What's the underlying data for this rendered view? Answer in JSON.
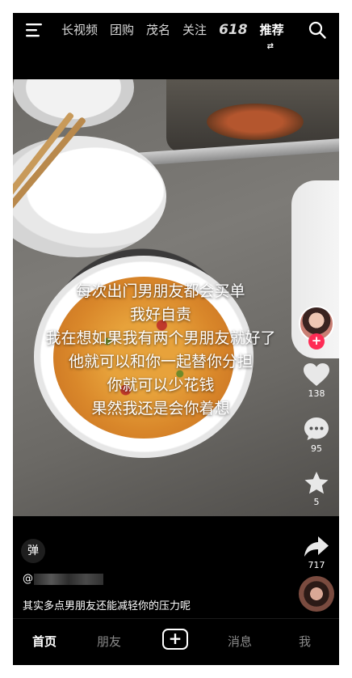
{
  "top_nav": {
    "menu_icon": "menu-icon",
    "tabs": [
      "长视频",
      "团购",
      "茂名",
      "关注",
      "618"
    ],
    "active_tab": "推荐",
    "search_icon": "search-icon"
  },
  "video": {
    "caption_lines": [
      "每次出门男朋友都会买单",
      "我好自责",
      "我在想如果我有两个男朋友就好了",
      "他就可以和你一起替你分担",
      "你就可以少花钱",
      "果然我还是会你着想"
    ]
  },
  "actions": {
    "follow_plus": "+",
    "likes": "138",
    "comments": "95",
    "favorites": "5",
    "shares": "717"
  },
  "info": {
    "danmu_label": "弹",
    "author_prefix": "@",
    "description": "其实多点男朋友还能减轻你的压力呢"
  },
  "tabbar": {
    "home": "首页",
    "friends": "朋友",
    "plus": "+",
    "messages": "消息",
    "me": "我"
  },
  "colors": {
    "accent": "#fe2c55",
    "background": "#000000",
    "inactive_text": "#8a8a8a"
  }
}
